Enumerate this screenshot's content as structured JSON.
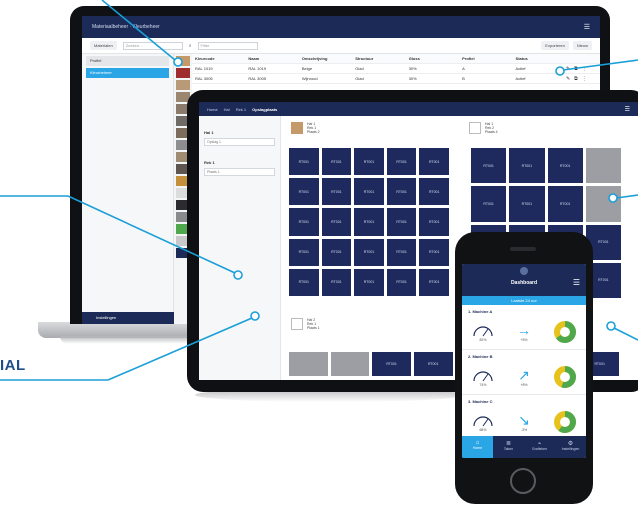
{
  "callout": {
    "label": "IAL"
  },
  "laptop": {
    "title": "Materiaalbeheer · Kleurbeheer",
    "menu_icon": "hamburger-icon",
    "toolbar": {
      "button_left": "Materialen",
      "search_placeholder": "Zoeken…",
      "filter_placeholder": "Filter",
      "button_right_1": "Exporteren",
      "button_right_2": "Nieuw"
    },
    "sidebar": {
      "items": [
        {
          "label": "Profiel"
        },
        {
          "label": "Kleurbeheer"
        }
      ],
      "bottom_label": "Instellingen"
    },
    "swatch_colors": [
      "#c59a6a",
      "#a02d2d",
      "#b89a78",
      "#9b8770",
      "#8a7a6c",
      "#6f6a66",
      "#7c6c5c",
      "#8e8e90",
      "#a08b73",
      "#5e5550",
      "#c4903c",
      "#dcdcdc",
      "#2c2c30",
      "#8a8a8c",
      "#4fa94c",
      "#c9c9cb",
      "#1b2a57"
    ],
    "table": {
      "headers": [
        "Kleurcode",
        "Naam",
        "Omschrijving",
        "Structuur",
        "Gloss",
        "Profiel",
        "Status"
      ],
      "rows": [
        [
          "RAL 1019",
          "RAL 1019",
          "Beige",
          "Glad",
          "30%",
          "A",
          "Actief"
        ],
        [
          "RAL 3005",
          "RAL 3005",
          "Wijnrood",
          "Glad",
          "30%",
          "B",
          "Actief"
        ]
      ]
    }
  },
  "tablet": {
    "breadcrumbs": [
      "Home",
      "Hal",
      "Rek 1",
      "Opslagplaats"
    ],
    "menu_icon": "hamburger-icon",
    "panel": {
      "title_1": "Hal 1",
      "field_1": "Opslag 1",
      "title_2": "Rek 1",
      "field_2": "Plaats 1"
    },
    "info_blocks": [
      {
        "lines": [
          "Hal 1",
          "Rek 1",
          "Plaats 2"
        ]
      },
      {
        "lines": [
          "Hal 1",
          "Rek 2",
          "Plaats 4"
        ]
      },
      {
        "lines": [
          "Hal 2",
          "Rek 1",
          "Plaats 1"
        ]
      }
    ],
    "cell_label": "RT001",
    "thumb_color": "#c59a6a"
  },
  "phone": {
    "title": "Dashboard",
    "menu_icon": "hamburger-icon",
    "subbar": "Laatste 24 uur",
    "sections": [
      {
        "title": "1. Machine A",
        "gauge": "82%",
        "trend": "+5%",
        "trend_dir": "right",
        "donut_ratio": 0.65
      },
      {
        "title": "2. Machine B",
        "gauge": "74%",
        "trend": "+8%",
        "trend_dir": "up",
        "donut_ratio": 0.55
      },
      {
        "title": "3. Machine C",
        "gauge": "68%",
        "trend": "-3%",
        "trend_dir": "down",
        "donut_ratio": 0.6
      }
    ],
    "nav": [
      {
        "label": "Home",
        "icon": "home-icon"
      },
      {
        "label": "Taken",
        "icon": "list-icon"
      },
      {
        "label": "Grafieken",
        "icon": "chart-icon"
      },
      {
        "label": "Instellingen",
        "icon": "settings-icon"
      }
    ],
    "colors": {
      "accent": "#2aa6e6",
      "navy": "#1b2a57",
      "donut_green": "#4fa94c",
      "donut_yellow": "#e8c21c"
    }
  }
}
